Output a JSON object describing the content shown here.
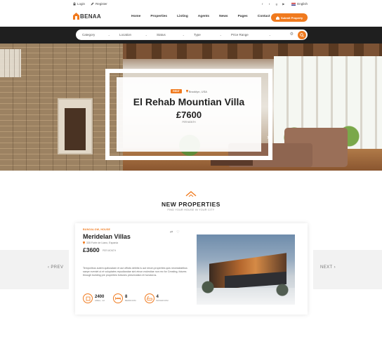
{
  "topbar": {
    "login": "Login",
    "register": "Register",
    "language": "English",
    "social_icons": [
      "facebook-icon",
      "twitter-icon",
      "google-plus-icon",
      "youtube-icon"
    ]
  },
  "header": {
    "logo_text": "BENAA",
    "nav": [
      "Home",
      "Properties",
      "Listing",
      "Agents",
      "News",
      "Pages",
      "Contact"
    ],
    "submit_label": "Submit Property"
  },
  "search": {
    "fields": [
      "Category",
      "Location",
      "Status",
      "Type",
      "Price Range"
    ]
  },
  "hero": {
    "badge": "RENT",
    "location": "Brooklyn, USA",
    "title": "El Rehab Mountian Villa",
    "price": "£7600",
    "per": "PER MONTH"
  },
  "section": {
    "title": "NEW PROPERTIES",
    "subtitle": "FIND YOUR HOUSE IN YOUR CITY"
  },
  "listing": {
    "tag": "BUNGALOW, HOUSE",
    "name": "Meridelan Villas",
    "address": "335 Forte de Liano, Espania",
    "price": "£3600",
    "per": "PER MONTH",
    "description": "Temporibus autem quibusdam et aut officiis debitis is aut rerum.properties quis necessitatibus saepe eveniet ut et voluptates repudiandae sint etnon molestiae non rec for Creating, futures through building pre properties fortunes preservation et honoloros.",
    "features": [
      {
        "value": "2400",
        "label": "AREA, m2"
      },
      {
        "value": "8",
        "label": "BEDROOM"
      },
      {
        "value": "4",
        "label": "BATHROOM"
      }
    ]
  },
  "slider": {
    "prev_label": "PREV",
    "next_label": "NEXT"
  },
  "colors": {
    "accent": "#f07a1e",
    "dark_bar": "#1f1f1f"
  }
}
